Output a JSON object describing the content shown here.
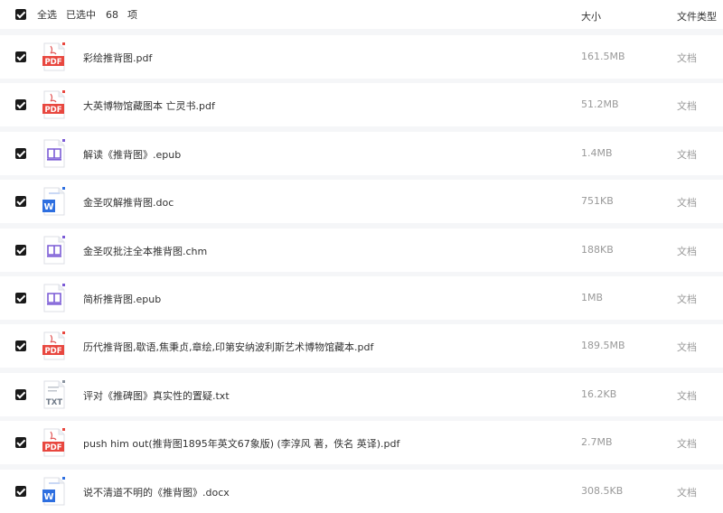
{
  "header": {
    "select_all": "全选",
    "selected": "已选中",
    "count": "68",
    "unit": "项",
    "col_size": "大小",
    "col_type": "文件类型"
  },
  "files": [
    {
      "name": "彩绘推背图.pdf",
      "size": "161.5MB",
      "type": "文档",
      "icon": "pdf-icon",
      "icon_label": "PDF"
    },
    {
      "name": "大英博物馆藏图本 亡灵书.pdf",
      "size": "51.2MB",
      "type": "文档",
      "icon": "pdf-icon",
      "icon_label": "PDF"
    },
    {
      "name": "解读《推背图》.epub",
      "size": "1.4MB",
      "type": "文档",
      "icon": "ebook-icon",
      "icon_label": ""
    },
    {
      "name": "金圣叹解推背图.doc",
      "size": "751KB",
      "type": "文档",
      "icon": "word-icon",
      "icon_label": "W"
    },
    {
      "name": "金圣叹批注全本推背图.chm",
      "size": "188KB",
      "type": "文档",
      "icon": "ebook-icon",
      "icon_label": ""
    },
    {
      "name": "简析推背图.epub",
      "size": "1MB",
      "type": "文档",
      "icon": "ebook-icon",
      "icon_label": ""
    },
    {
      "name": "历代推背图,歇语,焦秉贞,章绘,印第安纳波利斯艺术博物馆藏本.pdf",
      "size": "189.5MB",
      "type": "文档",
      "icon": "pdf-icon",
      "icon_label": "PDF"
    },
    {
      "name": "评对《推碑图》真实性的置疑.txt",
      "size": "16.2KB",
      "type": "文档",
      "icon": "txt-icon",
      "icon_label": "TXT"
    },
    {
      "name": "push him out(推背图1895年英文67象版) (李淳风 著，佚名 英译).pdf",
      "size": "2.7MB",
      "type": "文档",
      "icon": "pdf-icon",
      "icon_label": "PDF"
    },
    {
      "name": "说不清道不明的《推背图》.docx",
      "size": "308.5KB",
      "type": "文档",
      "icon": "word-icon",
      "icon_label": "W"
    }
  ]
}
